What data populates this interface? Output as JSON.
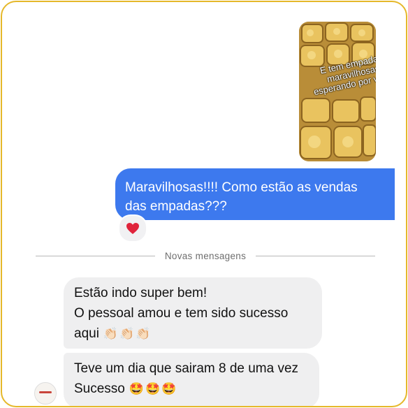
{
  "conversation": {
    "photo": {
      "caption_lines": [
        "E tem empadas",
        "maravilhosas",
        "esperando por vocês"
      ]
    },
    "sent_message": {
      "line1": "Maravilhosas!!!! Como estão as vendas",
      "line2": "das empadas???",
      "reaction": "heart-icon"
    },
    "divider": {
      "label": "Novas mensagens"
    },
    "received": [
      {
        "lines": [
          "Estão indo super bem!",
          "O pessoal amou e tem sido sucesso",
          "aqui"
        ],
        "emoji": "👏🏻👏🏻👏🏻"
      },
      {
        "lines": [
          "Teve um dia que sairam 8 de uma vez",
          "Sucesso"
        ],
        "emoji": "🤩🤩🤩"
      }
    ]
  },
  "colors": {
    "frame_border": "#e5b82a",
    "sent_bubble": "#3d79ee",
    "received_bubble": "#efeff0",
    "heart": "#e0243c"
  }
}
